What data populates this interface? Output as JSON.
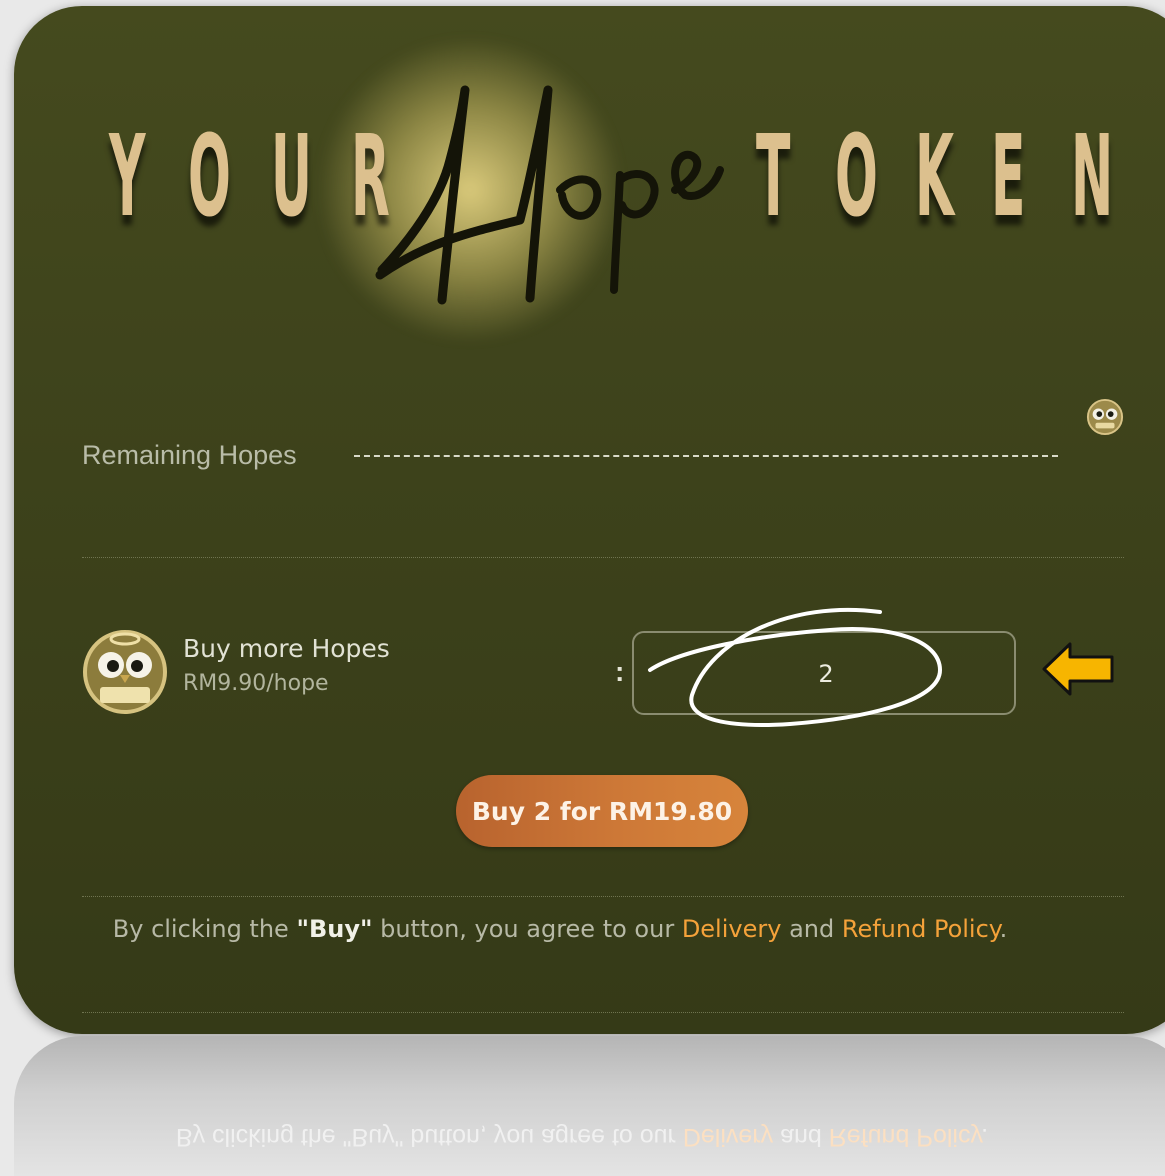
{
  "logo": {
    "word_left": "YOUR",
    "script": "Hope",
    "word_right": "TOKEN",
    "letter_color": "#dcc08e"
  },
  "balance": {
    "label": "Remaining Hopes"
  },
  "product": {
    "title": "Buy more Hopes",
    "price": "RM9.90/hope",
    "avatar_icon": "owl-hope-icon",
    "separator": ":",
    "quantity": "2"
  },
  "buy_button": {
    "label": "Buy 2 for RM19.80"
  },
  "terms": {
    "prefix": "By clicking the ",
    "button_ref": "\"Buy\"",
    "middle": " button, you agree to our ",
    "link_delivery": "Delivery",
    "and": " and ",
    "link_refund": "Refund Policy",
    "suffix": "."
  },
  "colors": {
    "card_bg": "#42471d",
    "accent_orange": "#d7843b",
    "link_orange": "#f4a23a",
    "arrow_yellow": "#f7b500"
  }
}
